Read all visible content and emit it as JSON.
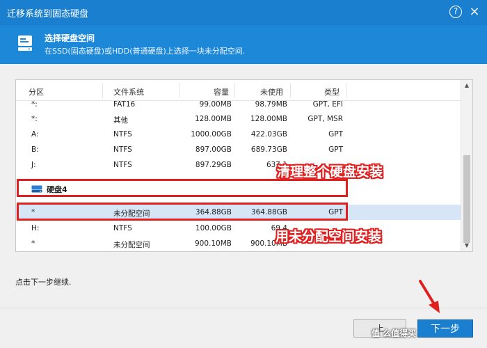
{
  "window": {
    "title": "迁移系统到固态硬盘",
    "help_label": "?",
    "close_label": "×"
  },
  "header": {
    "title": "选择硬盘空间",
    "description": "在SSD(固态硬盘)或HDD(普通硬盘)上选择一块未分配空间."
  },
  "table": {
    "columns": [
      "分区",
      "文件系统",
      "容量",
      "未使用",
      "类型"
    ],
    "rows_top": [
      {
        "partition": "*:",
        "fs": "FAT16",
        "capacity": "99.00MB",
        "unused": "98.79MB",
        "type": "GPT, EFI"
      },
      {
        "partition": "*:",
        "fs": "其他",
        "capacity": "128.00MB",
        "unused": "128.00MB",
        "type": "GPT, MSR"
      },
      {
        "partition": "A:",
        "fs": "NTFS",
        "capacity": "1000.00GB",
        "unused": "422.03GB",
        "type": "GPT"
      },
      {
        "partition": "B:",
        "fs": "NTFS",
        "capacity": "897.00GB",
        "unused": "689.73GB",
        "type": "GPT"
      },
      {
        "partition": "J:",
        "fs": "NTFS",
        "capacity": "897.29GB",
        "unused": "637.1",
        "type": ""
      }
    ],
    "disk_label": "硬盘4",
    "rows_bottom": [
      {
        "partition": "*",
        "fs": "未分配空间",
        "capacity": "364.88GB",
        "unused": "364.88GB",
        "type": "GPT"
      },
      {
        "partition": "H:",
        "fs": "NTFS",
        "capacity": "100.00GB",
        "unused": "69.4",
        "type": ""
      },
      {
        "partition": "*",
        "fs": "未分配空间",
        "capacity": "900.10MB",
        "unused": "900.10MB",
        "type": ""
      }
    ]
  },
  "annotations": {
    "clean_disk": "清理整个硬盘安装",
    "use_unallocated": "用未分配空间安装"
  },
  "footer": {
    "hint": "点击下一步继续.",
    "prev_label": "上",
    "next_label": "下一步",
    "watermark": "值 么值得买"
  },
  "colors": {
    "titlebar": "#1a7fcf",
    "header": "#1e88d8",
    "annotation": "#e02020",
    "selected_row": "#d6e6f7"
  }
}
